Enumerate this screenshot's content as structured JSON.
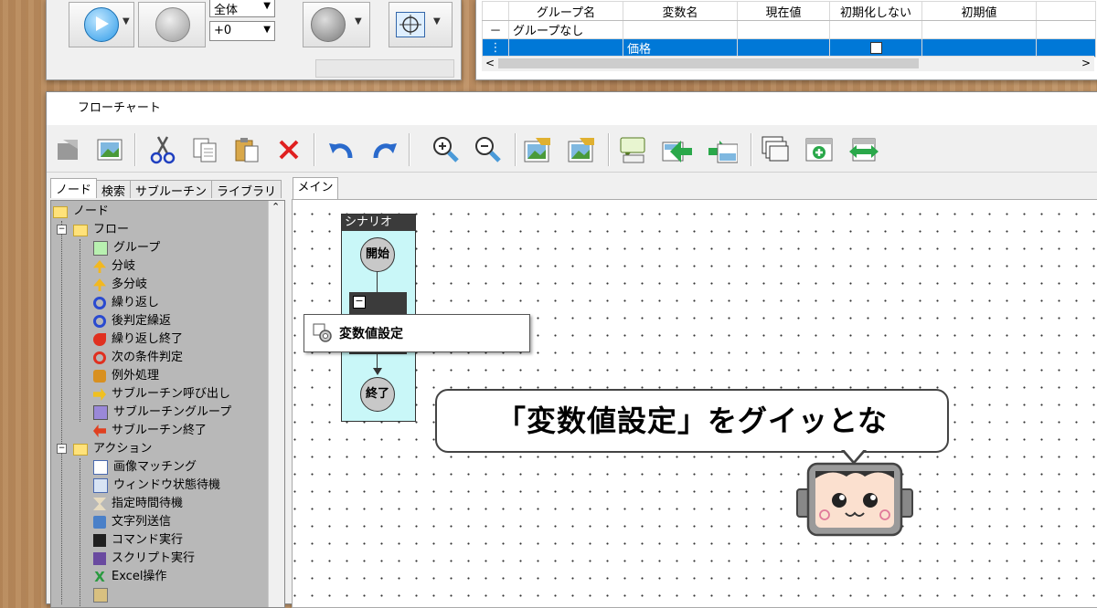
{
  "top_window": {
    "combo1_value": "全体",
    "combo2_value": "+0"
  },
  "variables_table": {
    "headers": [
      "グループ名",
      "変数名",
      "現在値",
      "初期化しない",
      "初期値"
    ],
    "rows": [
      {
        "marker": "－",
        "group": "グループなし",
        "name": "",
        "value": "",
        "no_init": false,
        "initial": ""
      },
      {
        "marker": "⋮",
        "group": "",
        "name": "価格",
        "value": "",
        "no_init": true,
        "initial": ""
      }
    ]
  },
  "flowchart_window": {
    "title": "フローチャート",
    "left_tabs": [
      "ノード",
      "検索",
      "サブルーチン",
      "ライブラリ"
    ],
    "main_tab": "メイン",
    "tree": [
      {
        "label": "ノード",
        "type": "folder",
        "level": 0
      },
      {
        "label": "フロー",
        "type": "folder",
        "level": 1
      },
      {
        "label": "グループ",
        "type": "item",
        "level": 2,
        "color": "#b8f0b0"
      },
      {
        "label": "分岐",
        "type": "item",
        "level": 2,
        "color": "#f2b820"
      },
      {
        "label": "多分岐",
        "type": "item",
        "level": 2,
        "color": "#f2b820"
      },
      {
        "label": "繰り返し",
        "type": "item",
        "level": 2,
        "color": "#2a4ad0"
      },
      {
        "label": "後判定繰返",
        "type": "item",
        "level": 2,
        "color": "#2a4ad0"
      },
      {
        "label": "繰り返し終了",
        "type": "item",
        "level": 2,
        "color": "#e03020"
      },
      {
        "label": "次の条件判定",
        "type": "item",
        "level": 2,
        "color": "#e03020"
      },
      {
        "label": "例外処理",
        "type": "item",
        "level": 2,
        "color": "#d89020"
      },
      {
        "label": "サブルーチン呼び出し",
        "type": "item",
        "level": 2,
        "color": "#f0c020"
      },
      {
        "label": "サブルーチングループ",
        "type": "item",
        "level": 2,
        "color": "#9a88d8"
      },
      {
        "label": "サブルーチン終了",
        "type": "item",
        "level": 2,
        "color": "#e04020"
      },
      {
        "label": "アクション",
        "type": "folder",
        "level": 1
      },
      {
        "label": "画像マッチング",
        "type": "item",
        "level": 2,
        "color": "#88a8d8"
      },
      {
        "label": "ウィンドウ状態待機",
        "type": "item",
        "level": 2,
        "color": "#88a8d8"
      },
      {
        "label": "指定時間待機",
        "type": "item",
        "level": 2,
        "color": "#d0c0a0"
      },
      {
        "label": "文字列送信",
        "type": "item",
        "level": 2,
        "color": "#4a80c8"
      },
      {
        "label": "コマンド実行",
        "type": "item",
        "level": 2,
        "color": "#202020"
      },
      {
        "label": "スクリプト実行",
        "type": "item",
        "level": 2,
        "color": "#6a4aa0"
      },
      {
        "label": "Excel操作",
        "type": "item",
        "level": 2,
        "color": "#2a9a40"
      }
    ],
    "scenario": {
      "header": "シナリオ",
      "start": "開始",
      "end": "終了"
    },
    "popup_label": "変数値設定",
    "callout": "「変数値設定」をグイッとな"
  }
}
